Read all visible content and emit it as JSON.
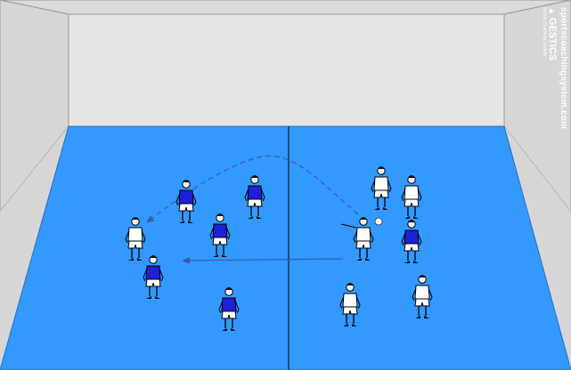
{
  "branding": {
    "website": "sportscoachingsystem.com",
    "name": "GESTICS",
    "tagline": "Sports Coaching System"
  },
  "court": {
    "floor_color": "#3399ff",
    "wall_color": "#e6e6e6",
    "side_wall_color": "#dcdcdc"
  },
  "teams": {
    "blue_shirt_color": "#1f1fd6",
    "white_shirt_color": "#ffffff"
  }
}
